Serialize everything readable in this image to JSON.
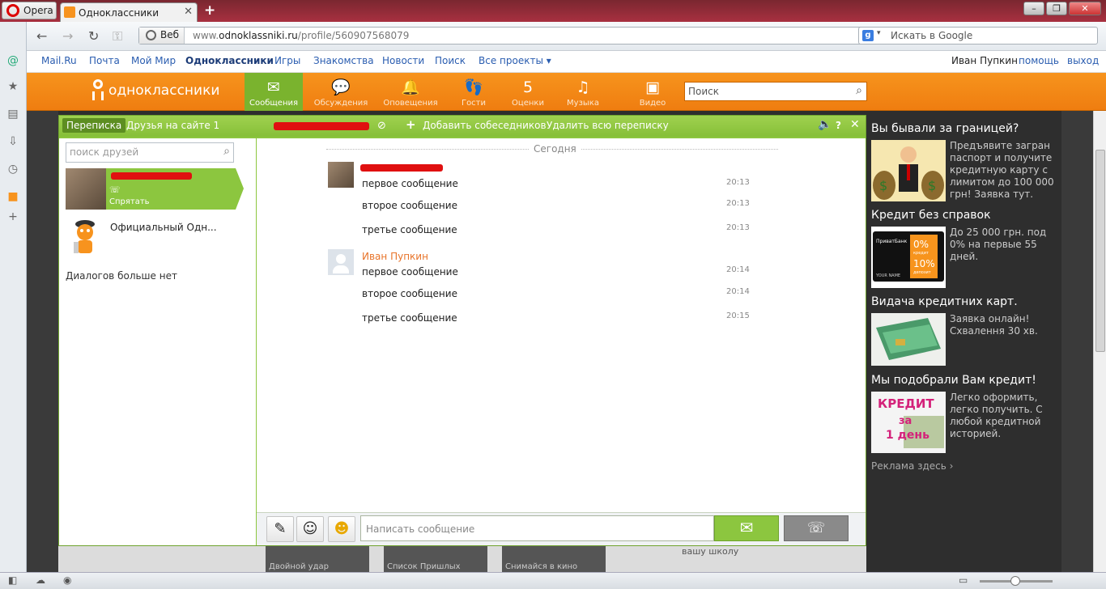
{
  "browser": {
    "opera_label": "Opera",
    "tab_title": "Одноклассники",
    "new_tab": "+",
    "web_label": "Веб",
    "url_prefix": "www.",
    "url_domain": "odnoklassniki.ru",
    "url_path": "/profile/560907568079",
    "search_placeholder": "Искать в Google",
    "search_engine_letter": "g"
  },
  "mailru_bar": {
    "links": [
      "Mail.Ru",
      "Почта",
      "Мой Мир",
      "Одноклассники",
      "Игры",
      "Знакомства",
      "Новости",
      "Поиск",
      "Все проекты ▾"
    ],
    "user_name": "Иван Пупкин",
    "help": "помощь",
    "logout": "выход"
  },
  "ok_header": {
    "logo_text": "одноклассники",
    "nav": [
      {
        "label": "Сообщения",
        "icon": "✉"
      },
      {
        "label": "Обсуждения",
        "icon": "💬"
      },
      {
        "label": "Оповещения",
        "icon": "🔔"
      },
      {
        "label": "Гости",
        "icon": "👣"
      },
      {
        "label": "Оценки",
        "icon": "5"
      },
      {
        "label": "Музыка",
        "icon": "♫"
      },
      {
        "label": "Видео",
        "icon": "▣"
      }
    ],
    "search_placeholder": "Поиск"
  },
  "chat": {
    "tab_active": "Переписка",
    "tab_friends": "Друзья на сайте 1",
    "add_participants": "Добавить собеседников",
    "delete_all": "Удалить всю переписку",
    "help_icon": "?",
    "close_icon": "✕",
    "friend_search_placeholder": "поиск друзей",
    "hide_label": "Спрятать",
    "official_name": "Официальный Одн...",
    "no_more": "Диалогов больше нет",
    "day_separator": "Сегодня",
    "messages_them": [
      {
        "text": "первое сообщение",
        "time": "20:13"
      },
      {
        "text": "второе сообщение",
        "time": "20:13"
      },
      {
        "text": "третье сообщение",
        "time": "20:13"
      }
    ],
    "me_name": "Иван Пупкин",
    "messages_me": [
      {
        "text": "первое сообщение",
        "time": "20:14"
      },
      {
        "text": "второе сообщение",
        "time": "20:14"
      },
      {
        "text": "третье сообщение",
        "time": "20:15"
      }
    ],
    "input_placeholder": "Написать сообщение"
  },
  "ads": [
    {
      "title": "Вы бывали за границей?",
      "text": "Предъявите загран паспорт и получите кредитную карту с лимитом до 100 000 грн! Заявка тут."
    },
    {
      "title": "Кредит без справок",
      "text": "До 25 000 грн. под 0% на первые 55 дней."
    },
    {
      "title": "Видача кредитних карт.",
      "text": "Заявка онлайн! Схвалення 30 хв."
    },
    {
      "title": "Мы подобрали Вам кредит!",
      "text": "Легко оформить, легко получить. С любой кредитной историей."
    }
  ],
  "ad_card": {
    "pct": "0%",
    "word": "кредит",
    "pct2": "10%",
    "word2": "депозит",
    "name": "YOUR NAME",
    "bank": "ПриватБанк"
  },
  "ad_credit_img": {
    "line1": "КРЕДИТ",
    "line2": "за",
    "line3": "1 день"
  },
  "ads_more": "Реклама здесь ›",
  "below_thumbs": [
    "Двойной удар",
    "Список Пришлых",
    "Снимайся в кино"
  ],
  "below_text": "вашу школу"
}
